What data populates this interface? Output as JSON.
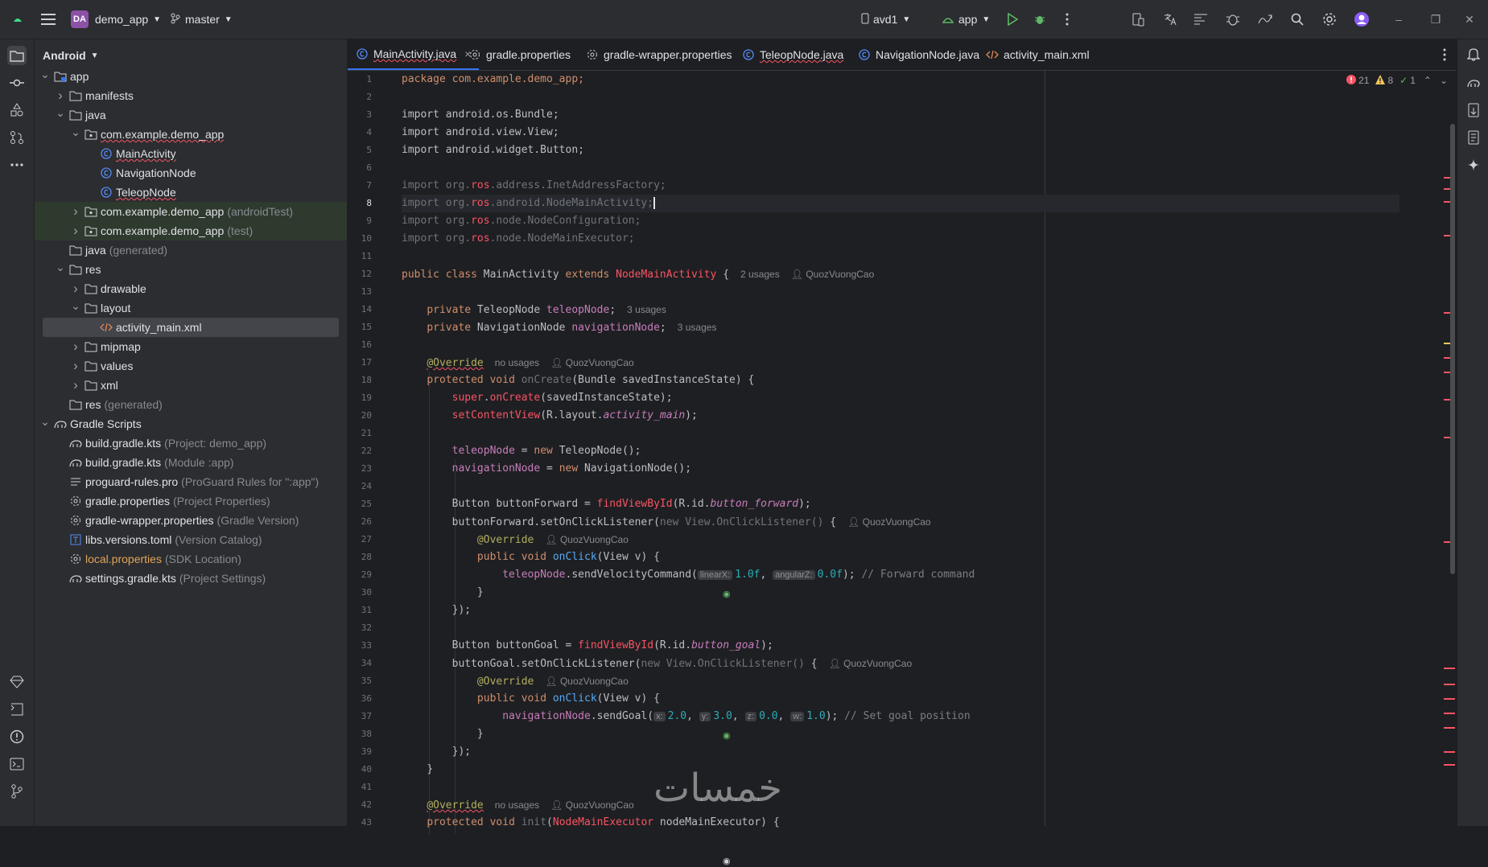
{
  "topbar": {
    "project_badge": "DA",
    "project_name": "demo_app",
    "branch": "master",
    "device": "avd1",
    "run_config": "app"
  },
  "project_panel": {
    "view_mode": "Android",
    "tree": [
      {
        "label": "app",
        "suffix": "",
        "level": 0,
        "expanded": true,
        "icon": "module-icon"
      },
      {
        "label": "manifests",
        "suffix": "",
        "level": 1,
        "expanded": false,
        "icon": "folder-icon"
      },
      {
        "label": "java",
        "suffix": "",
        "level": 1,
        "expanded": true,
        "icon": "folder-icon"
      },
      {
        "label": "com.example.demo_app",
        "suffix": "",
        "level": 2,
        "expanded": true,
        "icon": "package-icon",
        "error": true
      },
      {
        "label": "MainActivity",
        "suffix": "",
        "level": 3,
        "icon": "class-icon",
        "error": true
      },
      {
        "label": "NavigationNode",
        "suffix": "",
        "level": 3,
        "icon": "class-icon"
      },
      {
        "label": "TeleopNode",
        "suffix": "",
        "level": 3,
        "icon": "class-icon",
        "error": true
      },
      {
        "label": "com.example.demo_app",
        "suffix": "(androidTest)",
        "level": 2,
        "expanded": false,
        "icon": "package-icon",
        "green": true
      },
      {
        "label": "com.example.demo_app",
        "suffix": "(test)",
        "level": 2,
        "expanded": false,
        "icon": "package-icon",
        "green": true
      },
      {
        "label": "java",
        "suffix": "(generated)",
        "level": 1,
        "icon": "folder-icon"
      },
      {
        "label": "res",
        "suffix": "",
        "level": 1,
        "expanded": true,
        "icon": "folder-icon"
      },
      {
        "label": "drawable",
        "suffix": "",
        "level": 2,
        "expanded": false,
        "icon": "folder-icon"
      },
      {
        "label": "layout",
        "suffix": "",
        "level": 2,
        "expanded": true,
        "icon": "folder-icon"
      },
      {
        "label": "activity_main.xml",
        "suffix": "",
        "level": 3,
        "icon": "xml-icon",
        "selected": true
      },
      {
        "label": "mipmap",
        "suffix": "",
        "level": 2,
        "expanded": false,
        "icon": "folder-icon"
      },
      {
        "label": "values",
        "suffix": "",
        "level": 2,
        "expanded": false,
        "icon": "folder-icon"
      },
      {
        "label": "xml",
        "suffix": "",
        "level": 2,
        "expanded": false,
        "icon": "folder-icon"
      },
      {
        "label": "res",
        "suffix": "(generated)",
        "level": 1,
        "icon": "folder-icon"
      },
      {
        "label": "Gradle Scripts",
        "suffix": "",
        "level": 0,
        "expanded": true,
        "icon": "gradle-icon"
      },
      {
        "label": "build.gradle.kts",
        "suffix": "(Project: demo_app)",
        "level": 1,
        "icon": "gradle-file-icon"
      },
      {
        "label": "build.gradle.kts",
        "suffix": "(Module :app)",
        "level": 1,
        "icon": "gradle-file-icon"
      },
      {
        "label": "proguard-rules.pro",
        "suffix": "(ProGuard Rules for \":app\")",
        "level": 1,
        "icon": "text-file-icon"
      },
      {
        "label": "gradle.properties",
        "suffix": "(Project Properties)",
        "level": 1,
        "icon": "settings-file-icon"
      },
      {
        "label": "gradle-wrapper.properties",
        "suffix": "(Gradle Version)",
        "level": 1,
        "icon": "settings-file-icon"
      },
      {
        "label": "libs.versions.toml",
        "suffix": "(Version Catalog)",
        "level": 1,
        "icon": "toml-icon"
      },
      {
        "label": "local.properties",
        "suffix": "(SDK Location)",
        "level": 1,
        "icon": "settings-file-icon",
        "orange": true
      },
      {
        "label": "settings.gradle.kts",
        "suffix": "(Project Settings)",
        "level": 1,
        "icon": "gradle-file-icon"
      }
    ]
  },
  "tabs": [
    {
      "label": "MainActivity.java",
      "icon": "class-icon",
      "active": true,
      "error": true,
      "closable": true
    },
    {
      "label": "gradle.properties",
      "icon": "settings-file-icon"
    },
    {
      "label": "gradle-wrapper.properties",
      "icon": "settings-file-icon"
    },
    {
      "label": "TeleopNode.java",
      "icon": "class-icon",
      "error": true
    },
    {
      "label": "NavigationNode.java",
      "icon": "class-icon"
    },
    {
      "label": "activity_main.xml",
      "icon": "xml-icon"
    }
  ],
  "inspections": {
    "errors": "21",
    "warnings": "8",
    "ok": "1"
  },
  "current_line": "8",
  "line_numbers": [
    "1",
    "2",
    "3",
    "4",
    "5",
    "6",
    "7",
    "8",
    "9",
    "10",
    "11",
    "12",
    "13",
    "14",
    "15",
    "16",
    "17",
    "18",
    "19",
    "20",
    "21",
    "22",
    "23",
    "24",
    "25",
    "26",
    "27",
    "28",
    "29",
    "30",
    "31",
    "32",
    "33",
    "34",
    "35",
    "36",
    "37",
    "38",
    "39",
    "40",
    "41",
    "42",
    "43"
  ],
  "code": {
    "l1": "package com.example.demo_app;",
    "l3": "import android.os.Bundle;",
    "l4": "import android.view.View;",
    "l5": "import android.widget.Button;",
    "l7a": "import org.",
    "ros": "ros",
    "l7b": ".address.InetAddressFactory;",
    "l8b": ".android.NodeMainActivity;",
    "l9b": ".node.NodeConfiguration;",
    "l10b": ".node.NodeMainExecutor;",
    "public": "public",
    "class": "class",
    "extends": "extends",
    "private": "private",
    "protected": "protected",
    "void": "void",
    "new": "new",
    "super": "super",
    "l12_name": " MainActivity ",
    "l12_parent": "NodeMainActivity",
    "l12_end": " {",
    "usages2": "2 usages",
    "usages3": "3 usages",
    "no_usages": "no usages",
    "author": "QuozVuongCao",
    "l14_type": " TeleopNode ",
    "l14_field": "teleopNode",
    "l15_type": " NavigationNode ",
    "l15_field": "navigationNode",
    "override": "@Override",
    "onCreate": "onCreate",
    "l18_args": "(Bundle savedInstanceState) {",
    "l19_args": "(savedInstanceState);",
    "setContentView": "setContentView",
    "l20_a": "(R.layout.",
    "activity_main": "activity_main",
    "l20_b": ");",
    "l22_b": " = ",
    "l22_c": " TeleopNode();",
    "l23_c": " NavigationNode();",
    "l25_a": "Button buttonForward = ",
    "findViewById": "findViewById",
    "l25_b": "(R.id.",
    "button_forward": "button_forward",
    "l26_a": "buttonForward.setOnClickListener(",
    "l26_b": "new View.OnClickListener()",
    "onClick": "onClick",
    "l28_args": "(View v) {",
    "l29_b": ".sendVelocityCommand(",
    "linearX": "linearX:",
    "v1": "1.0f",
    "angularZ": "angularZ:",
    "v0": "0.0f",
    "l29_c": "); ",
    "cmt_forward": "// Forward command",
    "close_brace": "}",
    "close_paren": "});",
    "l33_a": "Button buttonGoal = ",
    "button_goal": "button_goal",
    "l34_a": "buttonGoal.setOnClickListener(",
    "l37_b": ".sendGoal(",
    "px": "x:",
    "gx": "2.0",
    "py": "y:",
    "gy": "3.0",
    "pz": "z:",
    "gz": "0.0",
    "pw": "w:",
    "gw": "1.0",
    "cmt_goal": "// Set goal position",
    "init": "init",
    "l43_type": "NodeMainExecutor",
    "l43_b": " nodeMainExecutor) {",
    "comma": ", "
  },
  "watermark": "خمسات"
}
